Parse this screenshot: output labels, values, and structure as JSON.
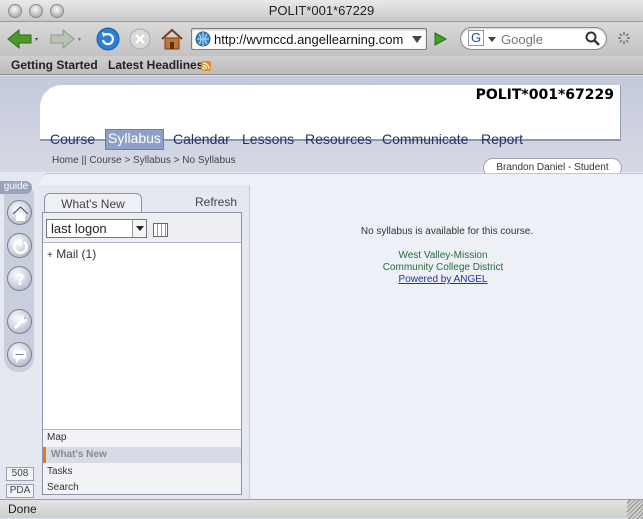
{
  "window": {
    "title": "POLIT*001*67229"
  },
  "toolbar": {
    "url": "http://wvmccd.angellearning.com",
    "search_placeholder": "Google"
  },
  "bookmarks": [
    "Getting Started",
    "Latest Headlines"
  ],
  "course": {
    "id": "POLIT*001*67229",
    "tabs": [
      "Course",
      "Syllabus",
      "Calendar",
      "Lessons",
      "Resources",
      "Communicate",
      "Report"
    ],
    "active_tab": "Syllabus"
  },
  "breadcrumb": "Home || Course > Syllabus > No Syllabus",
  "user": "Brandon Daniel - Student",
  "guide": {
    "label": "guide",
    "icons": [
      "home-icon",
      "power-icon",
      "help-icon",
      "wrench-icon",
      "chat-icon"
    ],
    "badges": [
      "508",
      "PDA"
    ]
  },
  "whats_new": {
    "tab_label": "What's New",
    "refresh_label": "Refresh",
    "filter_value": "last logon",
    "mail_item": "Mail (1)",
    "footer_items": [
      "Map",
      "What's New",
      "Tasks",
      "Search"
    ],
    "active_footer": "What's New"
  },
  "main": {
    "message": "No syllabus is available for this course.",
    "org_line1": "West Valley-Mission",
    "org_line2": "Community College District",
    "powered_by": "Powered by ANGEL"
  },
  "status": {
    "text": "Done"
  },
  "colors": {
    "tab_text": "#22336e",
    "tab_active_bg": "#8ea0c8",
    "link_green": "#2b6b3c",
    "link_blue": "#223399",
    "accent_orange": "#e07b1e"
  }
}
